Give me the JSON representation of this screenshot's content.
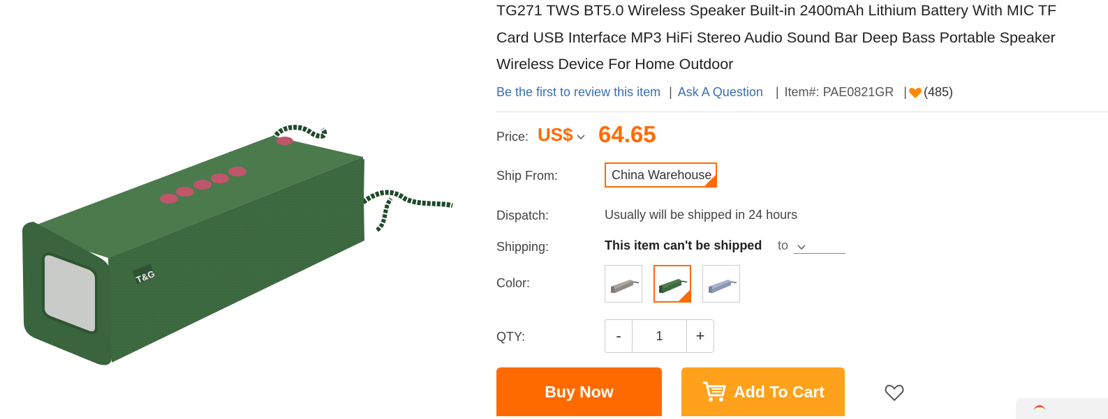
{
  "product": {
    "title_lines": [
      "TG271 TWS BT5.0 Wireless Speaker Built-in 2400mAh Lithium Battery With MIC TF",
      "Card USB Interface MP3 HiFi Stereo Audio Sound Bar Deep Bass Portable Speaker",
      "Wireless Device For Home Outdoor"
    ],
    "image_logo": "T&G"
  },
  "meta": {
    "review_link": "Be the first to review this item",
    "question_link": "Ask A Question",
    "item_number": "Item#: PAE0821GR",
    "favorites_count": "(485)"
  },
  "price": {
    "label": "Price:",
    "currency": "US$",
    "value": "64.65"
  },
  "ship_from": {
    "label": "Ship From:",
    "selected": "China Warehouse"
  },
  "dispatch": {
    "label": "Dispatch:",
    "value": "Usually will be shipped in 24 hours"
  },
  "shipping": {
    "label": "Shipping:",
    "status": "This item can't be shipped",
    "to_label": "to"
  },
  "color": {
    "label": "Color:",
    "options": [
      "gray",
      "green",
      "blue"
    ],
    "selected_index": 1
  },
  "qty": {
    "label": "QTY:",
    "minus": "-",
    "value": "1",
    "plus": "+"
  },
  "actions": {
    "buy_now": "Buy Now",
    "add_to_cart": "Add To Cart"
  },
  "colors": {
    "accent": "#ff6a00",
    "cart": "#ffa11a",
    "link": "#3a6fb5",
    "speaker_green": "#3f6b40"
  }
}
